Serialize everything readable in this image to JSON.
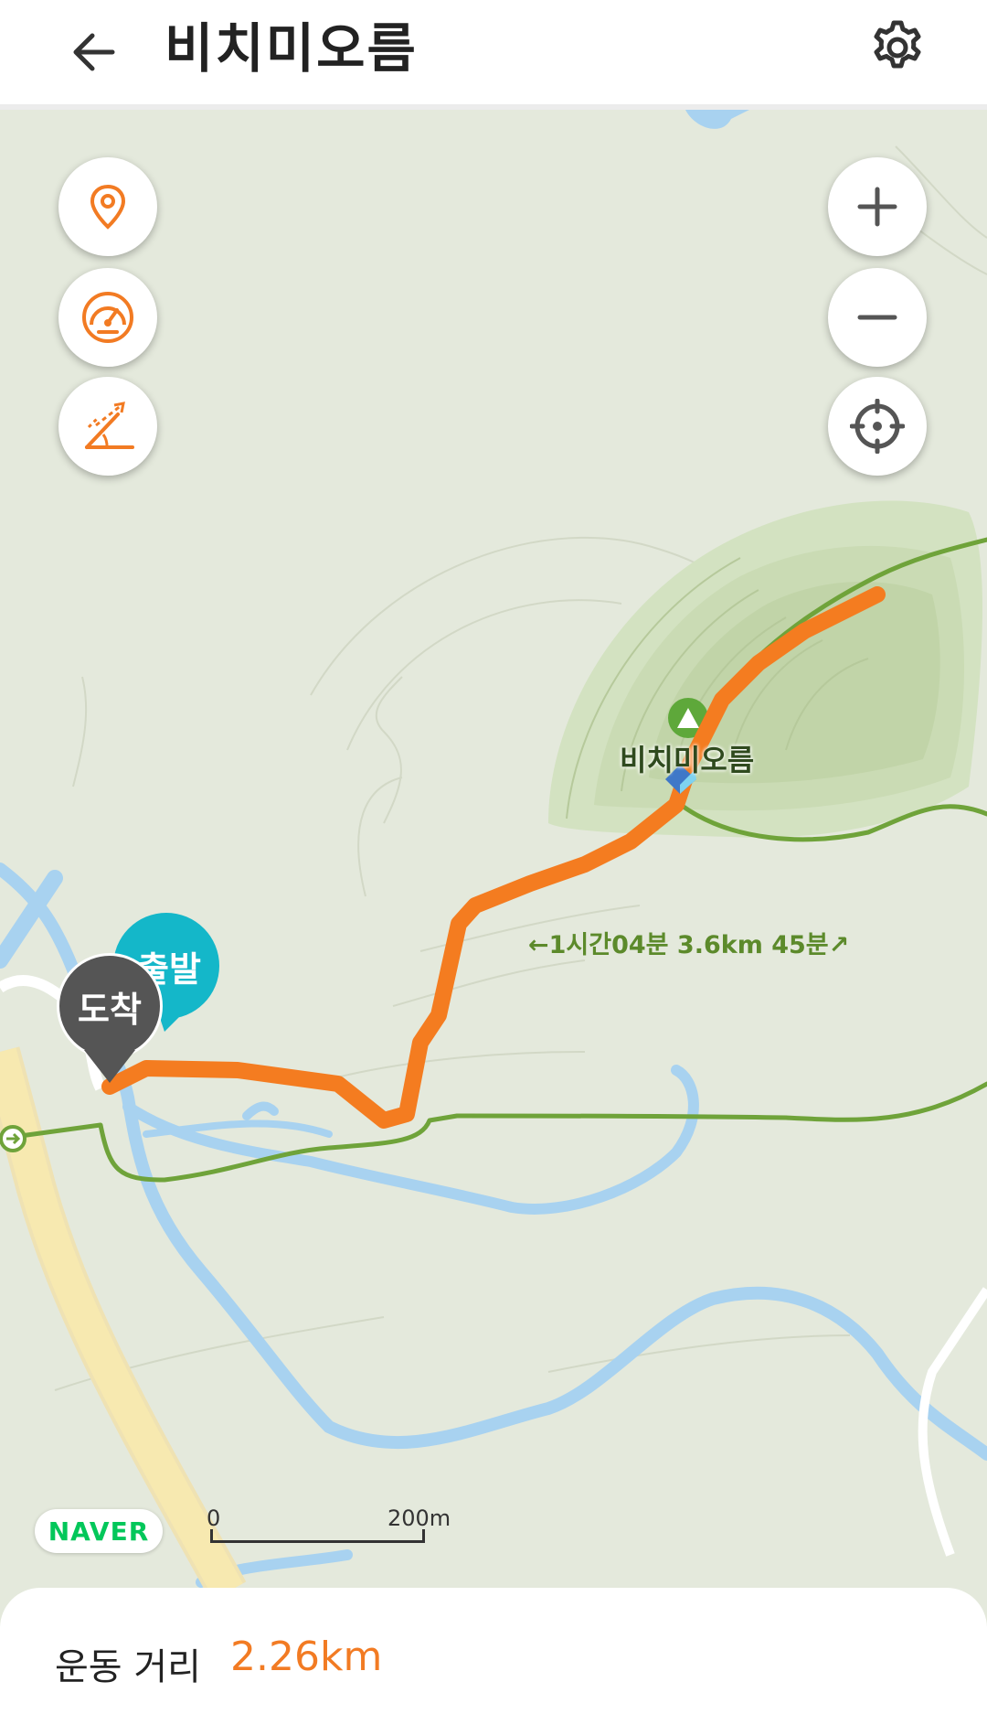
{
  "header": {
    "title": "비치미오름"
  },
  "map": {
    "peak_label": "비치미오름",
    "trail_label": "←1시간04분 3.6km 45분↗",
    "start_pin": "출발",
    "end_pin": "도착",
    "brand": "NAVER",
    "scale": {
      "start": "0",
      "end": "200m"
    }
  },
  "stats": {
    "distance_label": "운동 거리",
    "distance_value": "2.26km"
  },
  "colors": {
    "route": "#f47c20",
    "trail": "#6fa33a",
    "water": "#a8d2f0",
    "road": "#f6e6a6",
    "accent": "#f27b23",
    "start_pin": "#14b7c9",
    "end_pin": "#555555"
  }
}
